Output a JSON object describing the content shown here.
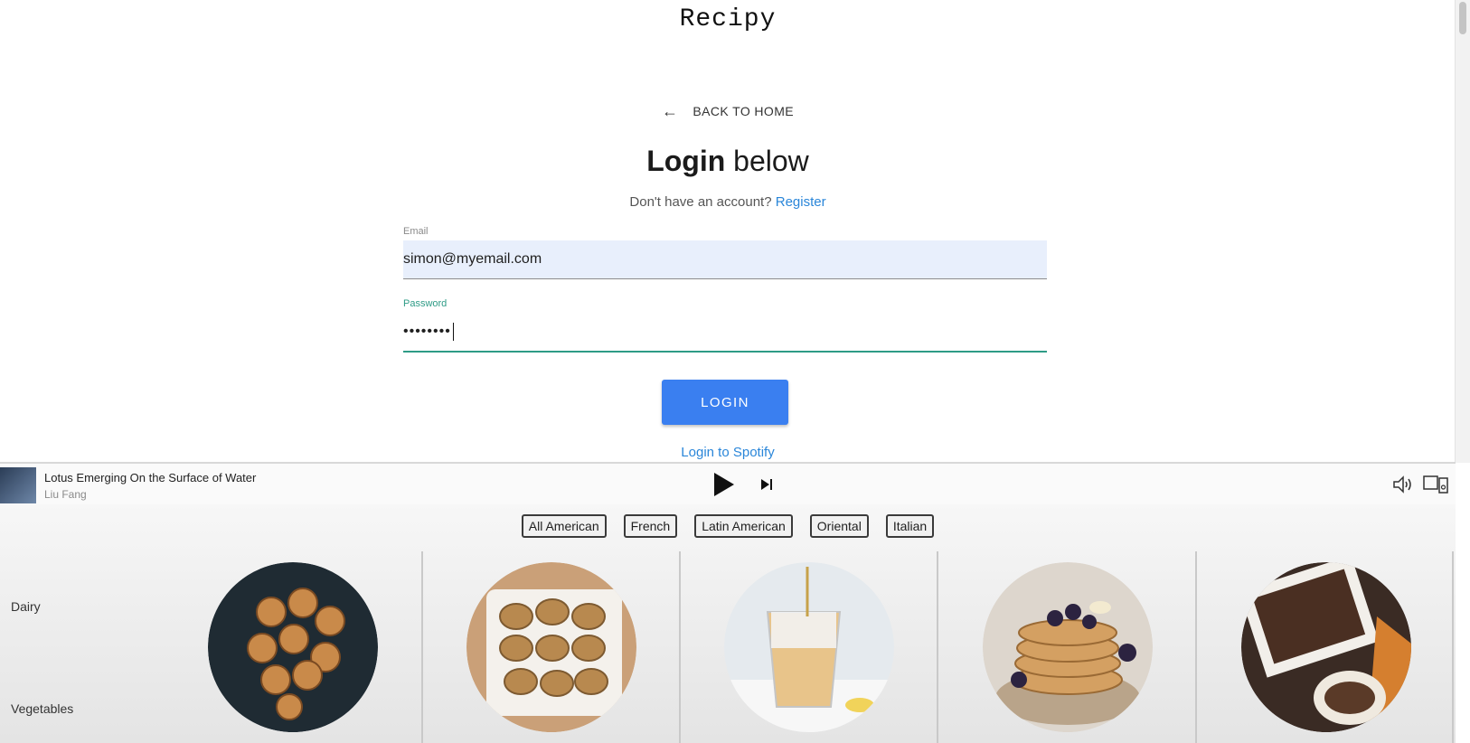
{
  "app": {
    "brand": "Recipy"
  },
  "nav": {
    "back_label": "BACK TO HOME"
  },
  "login": {
    "title_bold": "Login",
    "title_rest": " below",
    "prompt": "Don't have an account?",
    "register_label": "Register",
    "email_label": "Email",
    "email_value": "simon@myemail.com",
    "password_label": "Password",
    "password_value": "••••••••",
    "submit_label": "LOGIN",
    "spotify_label": "Login to Spotify"
  },
  "player": {
    "track": "Lotus Emerging On the Surface of Water",
    "artist": "Liu Fang"
  },
  "categories": {
    "tabs": [
      "All American",
      "French",
      "Latin American",
      "Oriental",
      "Italian"
    ],
    "side_labels": [
      "Dairy",
      "Vegetables"
    ]
  },
  "colors": {
    "accent": "#3a7ff0",
    "link": "#2a86d9",
    "focus": "#2e9b86",
    "autofill": "#e8effc"
  }
}
